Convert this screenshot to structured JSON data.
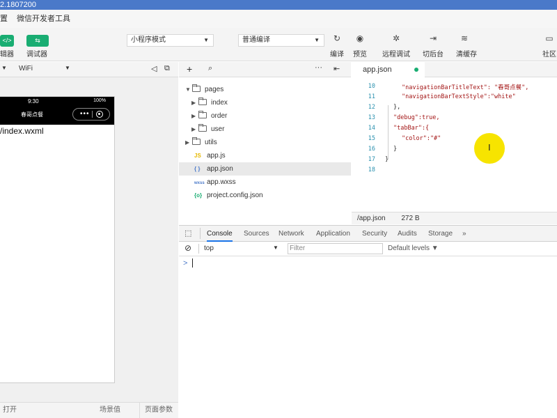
{
  "window": {
    "title": "2.1807200"
  },
  "menu": {
    "items": [
      "置",
      "微信开发者工具"
    ]
  },
  "toolbar": {
    "simulator_label": "辑器",
    "debugger_label": "调试器",
    "mode_select": "小程序模式",
    "compile_select": "普通编译",
    "actions": [
      "编译",
      "预览",
      "远程调试",
      "切后台",
      "清缓存"
    ],
    "community_label": "社区"
  },
  "simulator": {
    "network": "WiFi",
    "status_time": "9:30",
    "status_battery": "100%",
    "nav_title": "春哥点餐",
    "path": "/index.wxml",
    "bottom_left": "打开",
    "bottom_mid": "场景值",
    "bottom_right": "页面参数"
  },
  "tree": {
    "items": [
      {
        "name": "pages",
        "type": "folder",
        "expanded": true,
        "level": 0
      },
      {
        "name": "index",
        "type": "folder",
        "expanded": false,
        "level": 1
      },
      {
        "name": "order",
        "type": "folder",
        "expanded": false,
        "level": 1
      },
      {
        "name": "user",
        "type": "folder",
        "expanded": false,
        "level": 1
      },
      {
        "name": "utils",
        "type": "folder",
        "expanded": false,
        "level": 0
      },
      {
        "name": "app.js",
        "type": "js",
        "icon": "JS"
      },
      {
        "name": "app.json",
        "type": "json",
        "icon": "{ }",
        "selected": true
      },
      {
        "name": "app.wxss",
        "type": "wxss",
        "icon": "wxss"
      },
      {
        "name": "project.config.json",
        "type": "config",
        "icon": "{o}"
      }
    ]
  },
  "editor": {
    "tab": "app.json",
    "lines": [
      {
        "n": "10",
        "code": "\"navigationBarTitleText\": \"春哥点餐\","
      },
      {
        "n": "11",
        "code": "\"navigationBarTextStyle\":\"white\""
      },
      {
        "n": "12",
        "code": "},"
      },
      {
        "n": "13",
        "code": "\"debug\":true,"
      },
      {
        "n": "14",
        "code": "\"tabBar\":{"
      },
      {
        "n": "15",
        "code": "\"color\":\"#\""
      },
      {
        "n": "16",
        "code": "}"
      },
      {
        "n": "17",
        "code": "}"
      },
      {
        "n": "18",
        "code": ""
      }
    ],
    "status_path": "/app.json",
    "status_size": "272 B"
  },
  "devtools": {
    "tabs": [
      "Console",
      "Sources",
      "Network",
      "Application",
      "Security",
      "Audits",
      "Storage"
    ],
    "more": "»",
    "context": "top",
    "filter_placeholder": "Filter",
    "levels": "Default levels ▼",
    "prompt": ">"
  },
  "colors": {
    "titlebar": "#4a79c9",
    "accent_green": "#19ad72",
    "highlight": "#f7e400",
    "active_tab": "#1a73e8"
  }
}
